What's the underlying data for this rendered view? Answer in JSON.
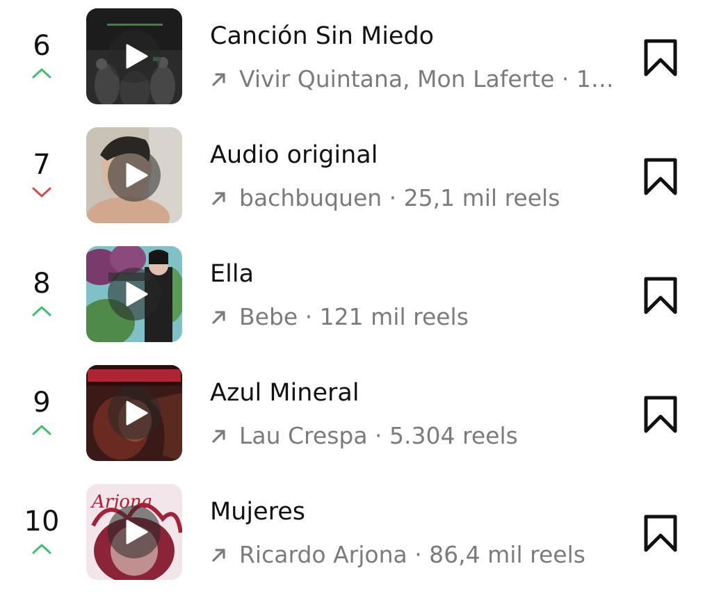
{
  "colors": {
    "trend_up": "#3fbf6c",
    "trend_down": "#d94a4a",
    "text_primary": "#111111",
    "text_secondary": "#7b7b7b"
  },
  "tracks": [
    {
      "rank": "6",
      "trend": "up",
      "title": "Canción Sin Miedo",
      "subtitle": "Vivir Quintana, Mon Laferte · 10,...",
      "cover_icon": "play-icon"
    },
    {
      "rank": "7",
      "trend": "down",
      "title": "Audio original",
      "subtitle": "bachbuquen · 25,1 mil reels",
      "cover_icon": "play-icon"
    },
    {
      "rank": "8",
      "trend": "up",
      "title": "Ella",
      "subtitle": "Bebe · 121 mil reels",
      "cover_icon": "play-icon"
    },
    {
      "rank": "9",
      "trend": "up",
      "title": "Azul Mineral",
      "subtitle": "Lau Crespa · 5.304 reels",
      "cover_icon": "play-icon"
    },
    {
      "rank": "10",
      "trend": "up",
      "title": "Mujeres",
      "subtitle": "Ricardo Arjona · 86,4 mil reels",
      "cover_icon": "play-icon",
      "cover_text": "Arjona"
    }
  ]
}
